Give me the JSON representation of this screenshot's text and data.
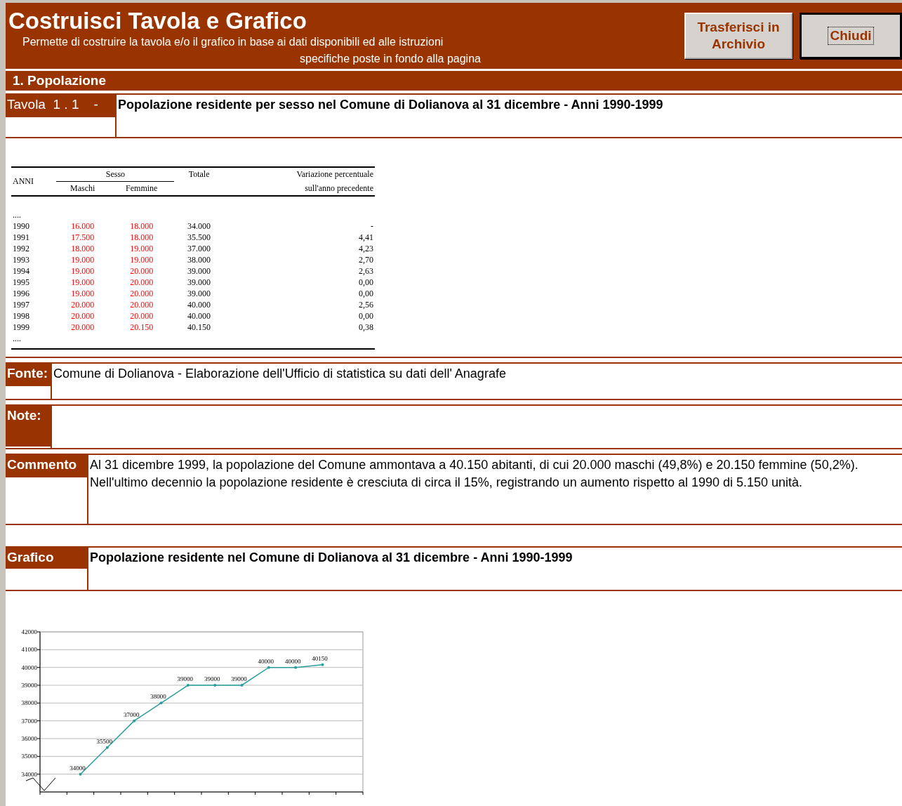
{
  "header": {
    "title": "Costruisci Tavola e Grafico",
    "subtitle_line_1": "Permette di costruire la tavola e/o il grafico  in base ai dati disponibili ed alle istruzioni",
    "subtitle_line_2": "specifiche poste in fondo alla pagina",
    "buttons": [
      {
        "label_line_1": "Trasferisci in",
        "label_line_2": "Archivio",
        "focused": false
      },
      {
        "label_line_1": "Chiudi",
        "focused": true
      }
    ]
  },
  "section": {
    "title": "1. Popolazione"
  },
  "table_heading": {
    "label": "Tavola  1 . 1    -",
    "title": "Popolazione residente per sesso nel Comune di Dolianova  al 31 dicembre - Anni 1990-1999"
  },
  "data_table": {
    "year_header": "ANNI",
    "group_header": "Sesso",
    "columns": [
      "Maschi",
      "Femmine"
    ],
    "total_header": "Totale",
    "change_header_line_1": "Variazione percentuale",
    "change_header_line_2": "sull'anno precedente",
    "ellipsis_top": "....",
    "ellipsis_bottom": "....",
    "rows": [
      {
        "year": "1990",
        "maschi": "16.000",
        "femmine": "18.000",
        "totale": "34.000",
        "variazione": "-"
      },
      {
        "year": "1991",
        "maschi": "17.500",
        "femmine": "18.000",
        "totale": "35.500",
        "variazione": "4,41"
      },
      {
        "year": "1992",
        "maschi": "18.000",
        "femmine": "19.000",
        "totale": "37.000",
        "variazione": "4,23"
      },
      {
        "year": "1993",
        "maschi": "19.000",
        "femmine": "19.000",
        "totale": "38.000",
        "variazione": "2,70"
      },
      {
        "year": "1994",
        "maschi": "19.000",
        "femmine": "20.000",
        "totale": "39.000",
        "variazione": "2,63"
      },
      {
        "year": "1995",
        "maschi": "19.000",
        "femmine": "20.000",
        "totale": "39.000",
        "variazione": "0,00"
      },
      {
        "year": "1996",
        "maschi": "19.000",
        "femmine": "20.000",
        "totale": "39.000",
        "variazione": "0,00"
      },
      {
        "year": "1997",
        "maschi": "20.000",
        "femmine": "20.000",
        "totale": "40.000",
        "variazione": "2,56"
      },
      {
        "year": "1998",
        "maschi": "20.000",
        "femmine": "20.000",
        "totale": "40.000",
        "variazione": "0,00"
      },
      {
        "year": "1999",
        "maschi": "20.000",
        "femmine": "20.150",
        "totale": "40.150",
        "variazione": "0,38"
      }
    ]
  },
  "fonte": {
    "label": "Fonte:",
    "text": "Comune di Dolianova  - Elaborazione dell'Ufficio di statistica su dati dell' Anagrafe"
  },
  "note": {
    "label": "Note:"
  },
  "commento": {
    "label": "Commento",
    "text": "Al 31 dicembre 1999, la popolazione del Comune ammontava a 40.150 abitanti, di cui 20.000 maschi (49,8%) e 20.150 femmine (50,2%). Nell'ultimo decennio la popolazione residente è cresciuta di circa il 15%, registrando un aumento rispetto al 1990 di 5.150 unità."
  },
  "grafico": {
    "label": "Grafico",
    "title": "Popolazione residente nel Comune di  Dolianova  al 31 dicembre - Anni 1990-1999",
    "chart_data": {
      "type": "line",
      "grid": true,
      "series": [
        {
          "color": "#2a9d9d",
          "values": [
            34000,
            35500,
            37000,
            38000,
            39000,
            39000,
            39000,
            40000,
            40000,
            40150
          ]
        }
      ],
      "ylim": [
        33000,
        42000
      ],
      "yticks": [
        34000,
        35000,
        36000,
        37000,
        38000,
        39000,
        40000,
        41000,
        42000
      ],
      "data_labels": true
    }
  }
}
